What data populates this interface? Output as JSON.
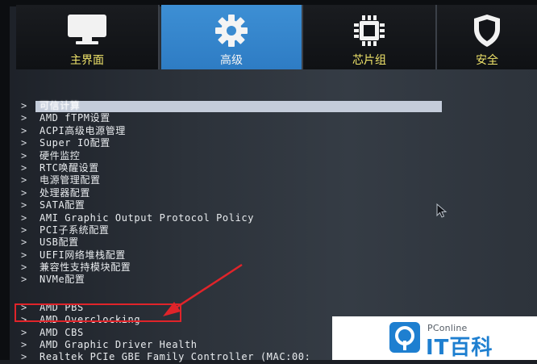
{
  "tabs": [
    {
      "label": "主界面",
      "icon": "monitor-icon"
    },
    {
      "label": "高级",
      "icon": "gear-icon"
    },
    {
      "label": "芯片组",
      "icon": "chip-icon"
    },
    {
      "label": "安全",
      "icon": "shield-icon"
    }
  ],
  "active_tab": 1,
  "menu": {
    "arrow": ">",
    "items": [
      {
        "label": "可信计算"
      },
      {
        "label": "AMD fTPM设置"
      },
      {
        "label": "ACPI高级电源管理"
      },
      {
        "label": "Super IO配置"
      },
      {
        "label": "硬件监控"
      },
      {
        "label": "RTC唤醒设置"
      },
      {
        "label": "电源管理配置"
      },
      {
        "label": "处理器配置"
      },
      {
        "label": "SATA配置"
      },
      {
        "label": "AMI Graphic Output Protocol Policy"
      },
      {
        "label": "PCI子系统配置"
      },
      {
        "label": "USB配置"
      },
      {
        "label": "UEFI网络堆栈配置"
      },
      {
        "label": "兼容性支持模块配置"
      },
      {
        "label": "NVMe配置"
      }
    ],
    "items2": [
      {
        "label": "AMD PBS"
      },
      {
        "label": "AMD Overclocking"
      },
      {
        "label": "AMD CBS"
      },
      {
        "label": "AMD Graphic Driver Health"
      },
      {
        "label": "Realtek PCIe GBE Family Controller (MAC:00:"
      }
    ]
  },
  "watermark": {
    "small": "PConline",
    "big": "IT百科"
  },
  "colors": {
    "active_tab": "#3a8bd0",
    "tab_label": "#f0e46a",
    "highlight": "#c4ccda",
    "annotation": "#e0242a",
    "logo_blue": "#1e7fd0"
  }
}
